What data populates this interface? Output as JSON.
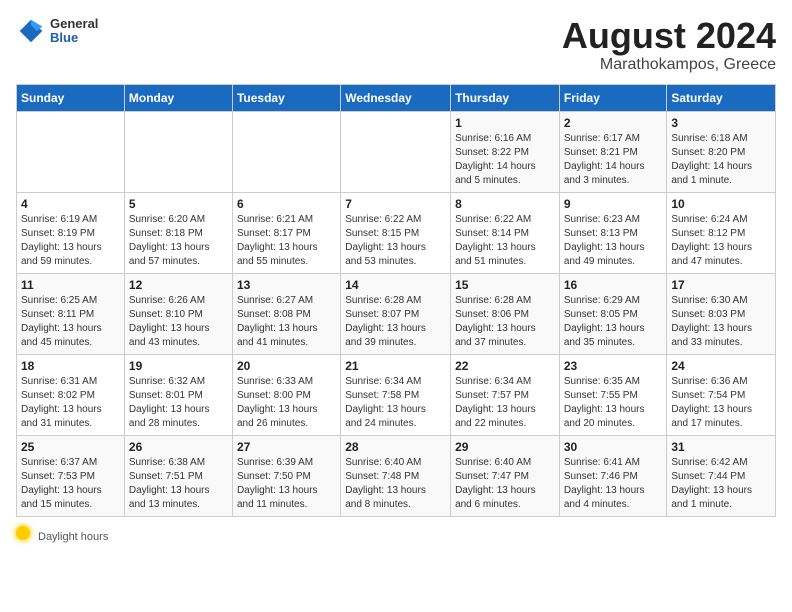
{
  "header": {
    "logo_general": "General",
    "logo_blue": "Blue",
    "title": "August 2024",
    "subtitle": "Marathokampos, Greece"
  },
  "days_of_week": [
    "Sunday",
    "Monday",
    "Tuesday",
    "Wednesday",
    "Thursday",
    "Friday",
    "Saturday"
  ],
  "weeks": [
    [
      {
        "day": "",
        "info": ""
      },
      {
        "day": "",
        "info": ""
      },
      {
        "day": "",
        "info": ""
      },
      {
        "day": "",
        "info": ""
      },
      {
        "day": "1",
        "info": "Sunrise: 6:16 AM\nSunset: 8:22 PM\nDaylight: 14 hours\nand 5 minutes."
      },
      {
        "day": "2",
        "info": "Sunrise: 6:17 AM\nSunset: 8:21 PM\nDaylight: 14 hours\nand 3 minutes."
      },
      {
        "day": "3",
        "info": "Sunrise: 6:18 AM\nSunset: 8:20 PM\nDaylight: 14 hours\nand 1 minute."
      }
    ],
    [
      {
        "day": "4",
        "info": "Sunrise: 6:19 AM\nSunset: 8:19 PM\nDaylight: 13 hours\nand 59 minutes."
      },
      {
        "day": "5",
        "info": "Sunrise: 6:20 AM\nSunset: 8:18 PM\nDaylight: 13 hours\nand 57 minutes."
      },
      {
        "day": "6",
        "info": "Sunrise: 6:21 AM\nSunset: 8:17 PM\nDaylight: 13 hours\nand 55 minutes."
      },
      {
        "day": "7",
        "info": "Sunrise: 6:22 AM\nSunset: 8:15 PM\nDaylight: 13 hours\nand 53 minutes."
      },
      {
        "day": "8",
        "info": "Sunrise: 6:22 AM\nSunset: 8:14 PM\nDaylight: 13 hours\nand 51 minutes."
      },
      {
        "day": "9",
        "info": "Sunrise: 6:23 AM\nSunset: 8:13 PM\nDaylight: 13 hours\nand 49 minutes."
      },
      {
        "day": "10",
        "info": "Sunrise: 6:24 AM\nSunset: 8:12 PM\nDaylight: 13 hours\nand 47 minutes."
      }
    ],
    [
      {
        "day": "11",
        "info": "Sunrise: 6:25 AM\nSunset: 8:11 PM\nDaylight: 13 hours\nand 45 minutes."
      },
      {
        "day": "12",
        "info": "Sunrise: 6:26 AM\nSunset: 8:10 PM\nDaylight: 13 hours\nand 43 minutes."
      },
      {
        "day": "13",
        "info": "Sunrise: 6:27 AM\nSunset: 8:08 PM\nDaylight: 13 hours\nand 41 minutes."
      },
      {
        "day": "14",
        "info": "Sunrise: 6:28 AM\nSunset: 8:07 PM\nDaylight: 13 hours\nand 39 minutes."
      },
      {
        "day": "15",
        "info": "Sunrise: 6:28 AM\nSunset: 8:06 PM\nDaylight: 13 hours\nand 37 minutes."
      },
      {
        "day": "16",
        "info": "Sunrise: 6:29 AM\nSunset: 8:05 PM\nDaylight: 13 hours\nand 35 minutes."
      },
      {
        "day": "17",
        "info": "Sunrise: 6:30 AM\nSunset: 8:03 PM\nDaylight: 13 hours\nand 33 minutes."
      }
    ],
    [
      {
        "day": "18",
        "info": "Sunrise: 6:31 AM\nSunset: 8:02 PM\nDaylight: 13 hours\nand 31 minutes."
      },
      {
        "day": "19",
        "info": "Sunrise: 6:32 AM\nSunset: 8:01 PM\nDaylight: 13 hours\nand 28 minutes."
      },
      {
        "day": "20",
        "info": "Sunrise: 6:33 AM\nSunset: 8:00 PM\nDaylight: 13 hours\nand 26 minutes."
      },
      {
        "day": "21",
        "info": "Sunrise: 6:34 AM\nSunset: 7:58 PM\nDaylight: 13 hours\nand 24 minutes."
      },
      {
        "day": "22",
        "info": "Sunrise: 6:34 AM\nSunset: 7:57 PM\nDaylight: 13 hours\nand 22 minutes."
      },
      {
        "day": "23",
        "info": "Sunrise: 6:35 AM\nSunset: 7:55 PM\nDaylight: 13 hours\nand 20 minutes."
      },
      {
        "day": "24",
        "info": "Sunrise: 6:36 AM\nSunset: 7:54 PM\nDaylight: 13 hours\nand 17 minutes."
      }
    ],
    [
      {
        "day": "25",
        "info": "Sunrise: 6:37 AM\nSunset: 7:53 PM\nDaylight: 13 hours\nand 15 minutes."
      },
      {
        "day": "26",
        "info": "Sunrise: 6:38 AM\nSunset: 7:51 PM\nDaylight: 13 hours\nand 13 minutes."
      },
      {
        "day": "27",
        "info": "Sunrise: 6:39 AM\nSunset: 7:50 PM\nDaylight: 13 hours\nand 11 minutes."
      },
      {
        "day": "28",
        "info": "Sunrise: 6:40 AM\nSunset: 7:48 PM\nDaylight: 13 hours\nand 8 minutes."
      },
      {
        "day": "29",
        "info": "Sunrise: 6:40 AM\nSunset: 7:47 PM\nDaylight: 13 hours\nand 6 minutes."
      },
      {
        "day": "30",
        "info": "Sunrise: 6:41 AM\nSunset: 7:46 PM\nDaylight: 13 hours\nand 4 minutes."
      },
      {
        "day": "31",
        "info": "Sunrise: 6:42 AM\nSunset: 7:44 PM\nDaylight: 13 hours\nand 1 minute."
      }
    ]
  ],
  "footer": {
    "daylight_label": "Daylight hours"
  }
}
